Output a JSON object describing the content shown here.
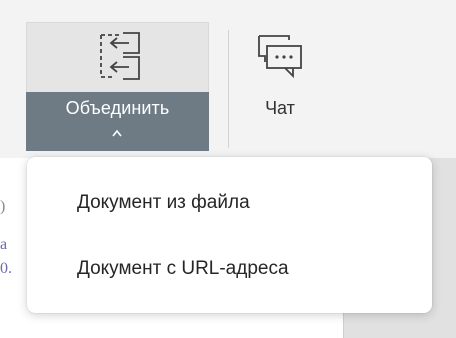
{
  "ribbon": {
    "merge": {
      "label": "Объединить",
      "icon": "merge-documents-icon"
    },
    "chat": {
      "label": "Чат",
      "icon": "chat-icon"
    }
  },
  "dropdown": {
    "items": [
      {
        "label": "Документ из файла"
      },
      {
        "label": "Документ с URL-адреса"
      }
    ]
  },
  "document": {
    "fragments": [
      ")",
      "a",
      "0."
    ]
  },
  "colors": {
    "ribbon_bg": "#f3f3f3",
    "active_split": "#6e7b85",
    "menu_bg": "#ffffff",
    "text": "#262626"
  }
}
